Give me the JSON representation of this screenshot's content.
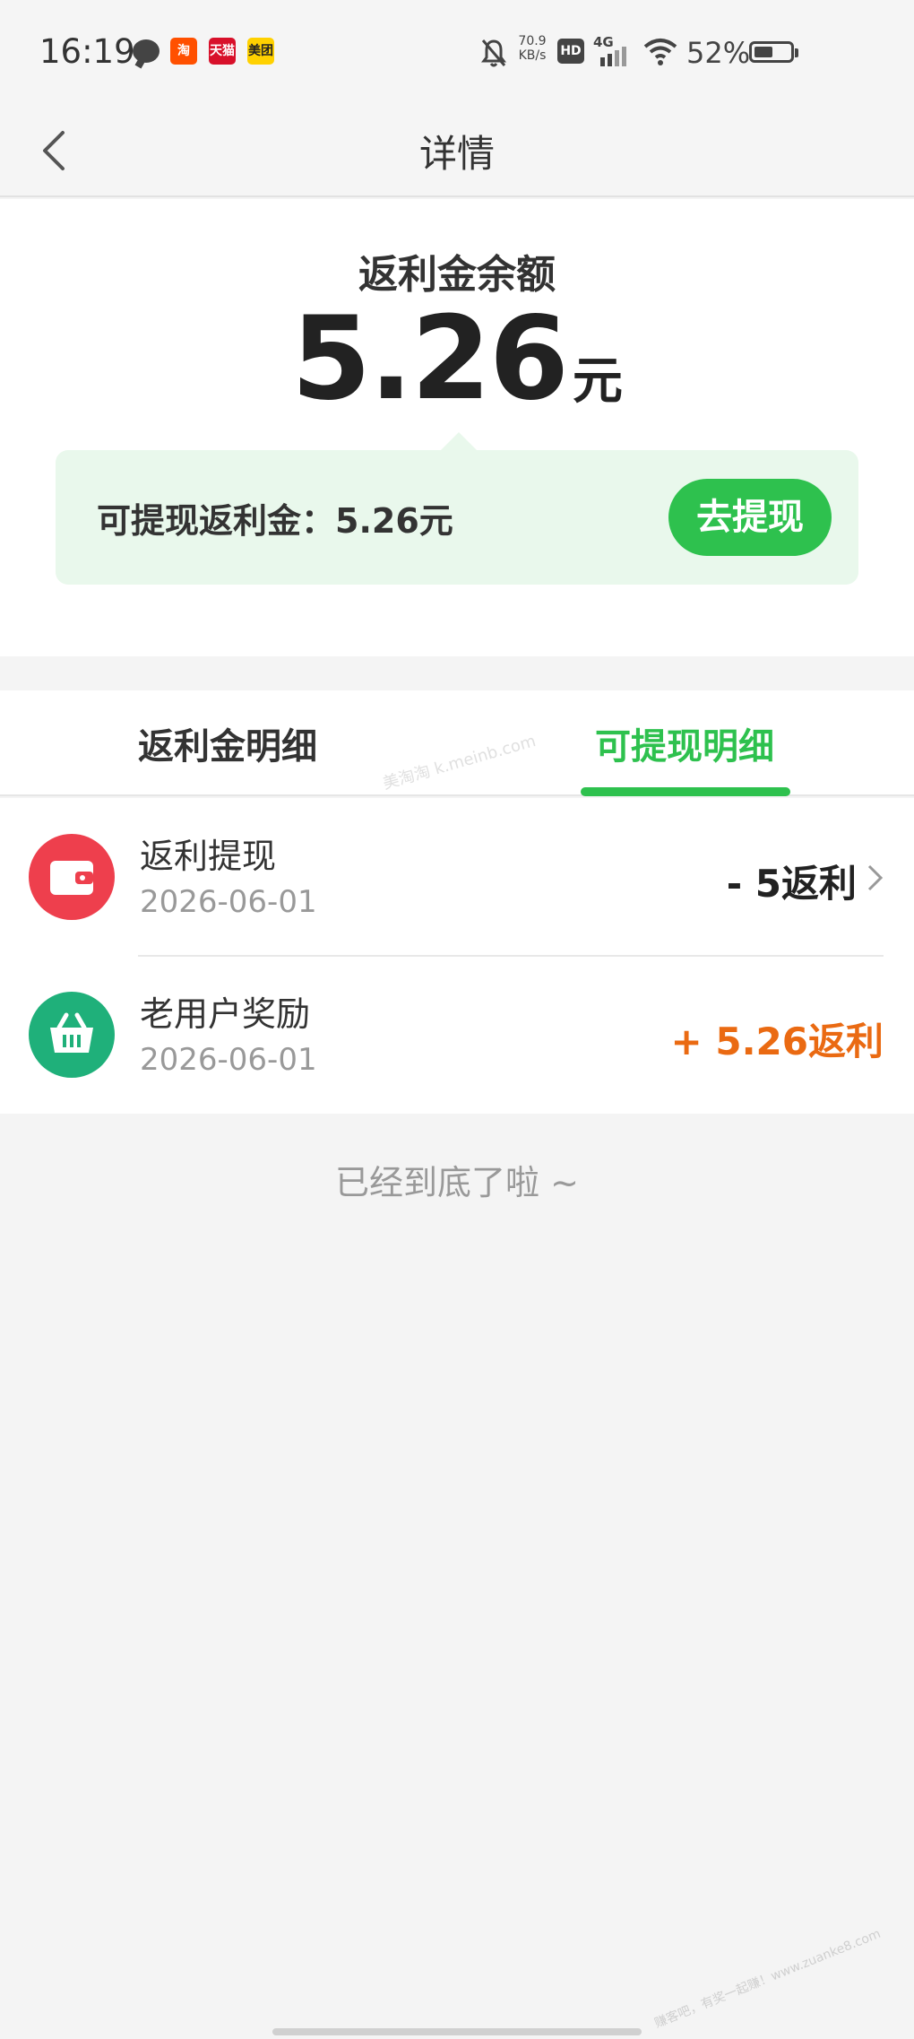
{
  "status_bar": {
    "time": "16:19",
    "net_speed": "70.9",
    "net_speed_unit": "KB/s",
    "hd_badge": "HD",
    "network_type": "4G",
    "battery_percent": "52%",
    "battery_level": 0.52,
    "notification_apps": [
      "chat-icon",
      "taobao-icon",
      "tmall-icon",
      "meituan-icon"
    ],
    "app_labels": {
      "taobao": "淘",
      "tmall": "天猫",
      "meituan": "美团"
    }
  },
  "nav": {
    "title": "详情"
  },
  "balance": {
    "label": "返利金余额",
    "amount": "5.26",
    "unit": "元",
    "withdrawable_text": "可提现返利金：5.26元",
    "withdraw_button": "去提现"
  },
  "tabs": {
    "items": [
      {
        "label": "返利金明细",
        "active": false
      },
      {
        "label": "可提现明细",
        "active": true
      }
    ],
    "watermark": "美淘淘 k.meinb.com"
  },
  "records": [
    {
      "title": "返利提现",
      "date": "2026-06-01",
      "amount": "- 5返利",
      "icon": "wallet-icon",
      "has_chevron": true
    },
    {
      "title": "老用户奖励",
      "date": "2026-06-01",
      "amount": "+ 5.26返利",
      "icon": "basket-icon",
      "has_chevron": false
    }
  ],
  "end_text": "已经到底了啦 ~",
  "corner_watermark": "赚客吧，有奖一起赚！www.zuanke8.com",
  "colors": {
    "accent_green": "#2ec14e",
    "positive_orange": "#ea6a12",
    "wallet_red": "#ee3f4d",
    "basket_green": "#1fb07a"
  }
}
